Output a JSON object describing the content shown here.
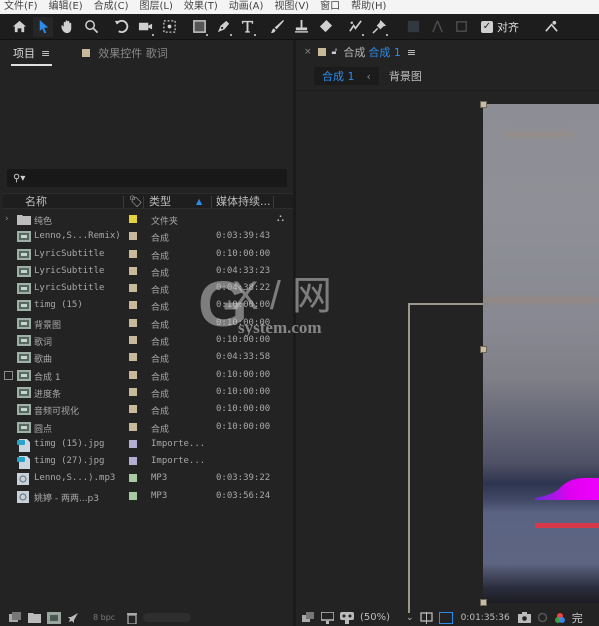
{
  "menubar": {
    "items": [
      "文件(F)",
      "编辑(E)",
      "合成(C)",
      "图层(L)",
      "效果(T)",
      "动画(A)",
      "视图(V)",
      "窗口",
      "帮助(H)"
    ]
  },
  "toolbar": {
    "tools": [
      "home-icon",
      "selection-tool-icon",
      "hand-tool-icon",
      "zoom-tool-icon",
      "rotate-tool-icon",
      "camera-tool-icon",
      "pan-behind-tool-icon",
      "rectangle-tool-icon",
      "pen-tool-icon",
      "type-tool-icon",
      "brush-tool-icon",
      "clone-stamp-tool-icon",
      "eraser-tool-icon",
      "roto-brush-tool-icon",
      "puppet-pin-tool-icon"
    ],
    "snap_label": "对齐",
    "snap_checked": true
  },
  "project_panel": {
    "tab_label": "项目",
    "effects_tab_label": "效果控件 歌词",
    "effects_tab_swatch": "#c8b99a",
    "search_placeholder": "",
    "columns": {
      "name": "名称",
      "type": "类型",
      "duration": "媒体持续..."
    },
    "items": [
      {
        "name": "纯色",
        "kind": "folder",
        "label_color": "#e3d23a",
        "type": "文件夹",
        "duration": "",
        "expanded": false
      },
      {
        "name": "Lenno,S...Remix)",
        "kind": "comp",
        "label_color": "#c8b99a",
        "type": "合成",
        "duration": "0:03:39:43"
      },
      {
        "name": "LyricSubtitle",
        "kind": "comp",
        "label_color": "#c8b99a",
        "type": "合成",
        "duration": "0:10:00:00"
      },
      {
        "name": "LyricSubtitle",
        "kind": "comp",
        "label_color": "#c8b99a",
        "type": "合成",
        "duration": "0:04:33:23"
      },
      {
        "name": "LyricSubtitle",
        "kind": "comp",
        "label_color": "#c8b99a",
        "type": "合成",
        "duration": "0:04:38:22"
      },
      {
        "name": "timg (15)",
        "kind": "comp",
        "label_color": "#c8b99a",
        "type": "合成",
        "duration": "0:10:00:00"
      },
      {
        "name": "背景图",
        "kind": "comp",
        "label_color": "#c8b99a",
        "type": "合成",
        "duration": "0:10:00:00"
      },
      {
        "name": "歌词",
        "kind": "comp",
        "label_color": "#c8b99a",
        "type": "合成",
        "duration": "0:10:00:00"
      },
      {
        "name": "歌曲",
        "kind": "comp",
        "label_color": "#c8b99a",
        "type": "合成",
        "duration": "0:04:33:58"
      },
      {
        "name": "合成 1",
        "kind": "comp",
        "label_color": "#c8b99a",
        "type": "合成",
        "duration": "0:10:00:00",
        "checkbox": true
      },
      {
        "name": "进度条",
        "kind": "comp",
        "label_color": "#c8b99a",
        "type": "合成",
        "duration": "0:10:00:00"
      },
      {
        "name": "音频可视化",
        "kind": "comp",
        "label_color": "#c8b99a",
        "type": "合成",
        "duration": "0:10:00:00"
      },
      {
        "name": "圆点",
        "kind": "comp",
        "label_color": "#c8b99a",
        "type": "合成",
        "duration": "0:10:00:00"
      },
      {
        "name": "timg (15).jpg",
        "kind": "image",
        "label_color": "#b3aed2",
        "type": "Importe...",
        "duration": ""
      },
      {
        "name": "timg (27).jpg",
        "kind": "image",
        "label_color": "#b3aed2",
        "type": "Importe...",
        "duration": ""
      },
      {
        "name": "Lenno,S...).mp3",
        "kind": "audio",
        "label_color": "#a9c9a4",
        "type": "MP3",
        "duration": "0:03:39:22"
      },
      {
        "name": "姚婷 - 两两...p3",
        "kind": "audio",
        "label_color": "#a9c9a4",
        "type": "MP3",
        "duration": "0:03:56:24"
      }
    ],
    "footer": {
      "bpc_label": "8 bpc"
    }
  },
  "composition_panel": {
    "tab_prefix": "合成",
    "tab_name": "合成 1",
    "tab_swatch": "#c8b99a",
    "breadcrumbs": [
      "合成 1",
      "背景图"
    ],
    "footer": {
      "zoom_level": "(50%)",
      "timecode": "0:01:35:36"
    }
  },
  "watermark": {
    "logo": "G",
    "text": "X / 网",
    "domain": "system.com"
  },
  "colors": {
    "accent": "#2d8ceb",
    "panel_bg": "#232323",
    "comp_label": "#c8b99a",
    "folder_label": "#e3d23a",
    "image_label": "#b3aed2",
    "audio_label": "#a9c9a4"
  }
}
